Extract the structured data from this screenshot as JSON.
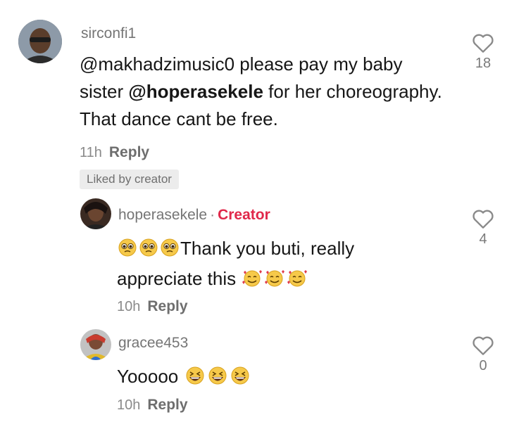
{
  "comments": [
    {
      "username": "sirconfi1",
      "text_parts": [
        "@makhadzimusic0",
        " please pay my baby sister ",
        "@hoperasekele",
        " for her choreography. That dance cant be free."
      ],
      "time": "11h",
      "reply_label": "Reply",
      "badge": "Liked by creator",
      "likes": "18"
    },
    {
      "username": "hoperasekele",
      "separator": "·",
      "role": "Creator",
      "text_line1": "Thank you buti, really",
      "text_line2": "appreciate this",
      "emoji_before": [
        "pleading-face",
        "pleading-face",
        "pleading-face"
      ],
      "emoji_after": [
        "smiling-face-with-hearts",
        "smiling-face-with-hearts",
        "smiling-face-with-hearts"
      ],
      "time": "10h",
      "reply_label": "Reply",
      "likes": "4"
    },
    {
      "username": "gracee453",
      "text": "Yooooo",
      "emoji_after": [
        "grinning-squinting-face",
        "grinning-squinting-face",
        "grinning-squinting-face"
      ],
      "time": "10h",
      "reply_label": "Reply",
      "likes": "0"
    }
  ],
  "colors": {
    "creator_accent": "#e0284a",
    "meta_gray": "#8a8a8a",
    "text": "#161616"
  }
}
